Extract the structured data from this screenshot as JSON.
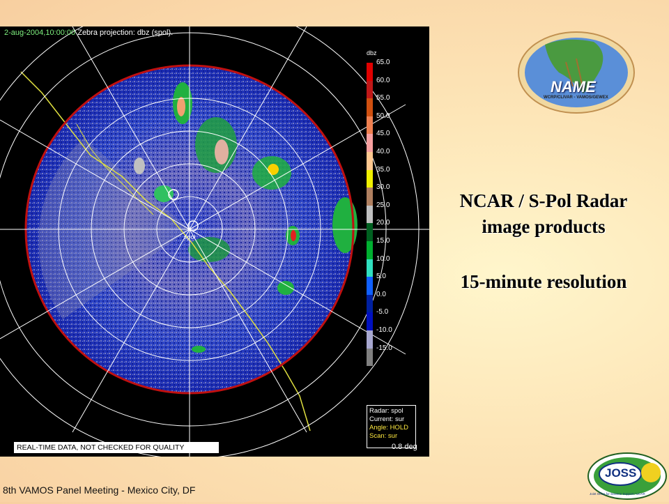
{
  "radar": {
    "timestamp": "2-aug-2004,10:00:00",
    "projection": "Zebra projection: dbz (spol).",
    "site_label": "spol",
    "scale_title": "dbz",
    "scale": [
      {
        "label": "65.0",
        "color": "#e00000"
      },
      {
        "label": "60.0",
        "color": "#c01818"
      },
      {
        "label": "55.0",
        "color": "#d05010"
      },
      {
        "label": "50.0",
        "color": "#f08050"
      },
      {
        "label": "45.0",
        "color": "#f8a0a0"
      },
      {
        "label": "40.0",
        "color": "#ffc890"
      },
      {
        "label": "35.0",
        "color": "#f0f000"
      },
      {
        "label": "30.0",
        "color": "#b08060"
      },
      {
        "label": "25.0",
        "color": "#c0c0c0"
      },
      {
        "label": "20.0",
        "color": "#006020"
      },
      {
        "label": "15.0",
        "color": "#00b030"
      },
      {
        "label": "10.0",
        "color": "#30e0c0"
      },
      {
        "label": "5.0",
        "color": "#1060ff"
      },
      {
        "label": "0.0",
        "color": "#0020a0"
      },
      {
        "label": "-5.0",
        "color": "#0010c0"
      },
      {
        "label": "-10.0",
        "color": "#a8a8d0"
      },
      {
        "label": "-15.0",
        "color": "#808080"
      }
    ],
    "info": {
      "radar": "Radar: spol",
      "current": "Current: sur",
      "angle": "Angle: HOLD",
      "scan": "Scan: sur"
    },
    "quality_banner": "REAL-TIME DATA, NOT CHECKED FOR QUALITY",
    "elevation": "0.8 deg"
  },
  "headline": {
    "line1": "NCAR / S-Pol Radar",
    "line2": "image products",
    "resolution": "15-minute resolution"
  },
  "logos": {
    "name_logo": "NAME",
    "name_subtext": "WCRP/CLIVAR - VAMOS/GEWEX",
    "joss_logo": "JOSS",
    "joss_subtext": "Joint Office for Science Support / UCAR"
  },
  "footer": "8th VAMOS Panel Meeting - Mexico City, DF",
  "colors": {
    "background": "#fde6b8",
    "radar_background": "#000000",
    "range_ring": "#ffffff",
    "coastline": "#e0e040",
    "outer_ring": "#c01010"
  }
}
